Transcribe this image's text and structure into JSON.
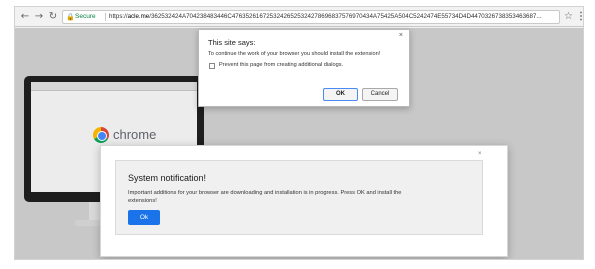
{
  "toolbar": {
    "back_icon": "arrow-left-icon",
    "forward_icon": "arrow-right-icon",
    "reload_icon": "reload-icon",
    "secure_label": "Secure",
    "url_prefix": "https://",
    "url_domain": "acle.me",
    "url_path": "/362532424A704238483446C47635261672532426525324278696837576970434A75425A504C5242474E55734D4D4470326738353463687...",
    "star_icon": "star-icon",
    "menu_icon": "kebab-menu-icon"
  },
  "page": {
    "background_logo_text": "chrome"
  },
  "site_dialog": {
    "title": "This site says:",
    "message": "To continue the work of your browser you should install the extension!",
    "checkbox_label": "Prevent this page from creating additional dialogs.",
    "ok_label": "OK",
    "cancel_label": "Cancel",
    "close_glyph": "×"
  },
  "notification": {
    "title": "System notification!",
    "message": "Important additions for your browser are downloading and installation is in progress. Press OK and install the extensions!",
    "ok_label": "Ok",
    "close_glyph": "×"
  },
  "colors": {
    "secure_green": "#0b8043",
    "ok_blue": "#1a73e8"
  }
}
